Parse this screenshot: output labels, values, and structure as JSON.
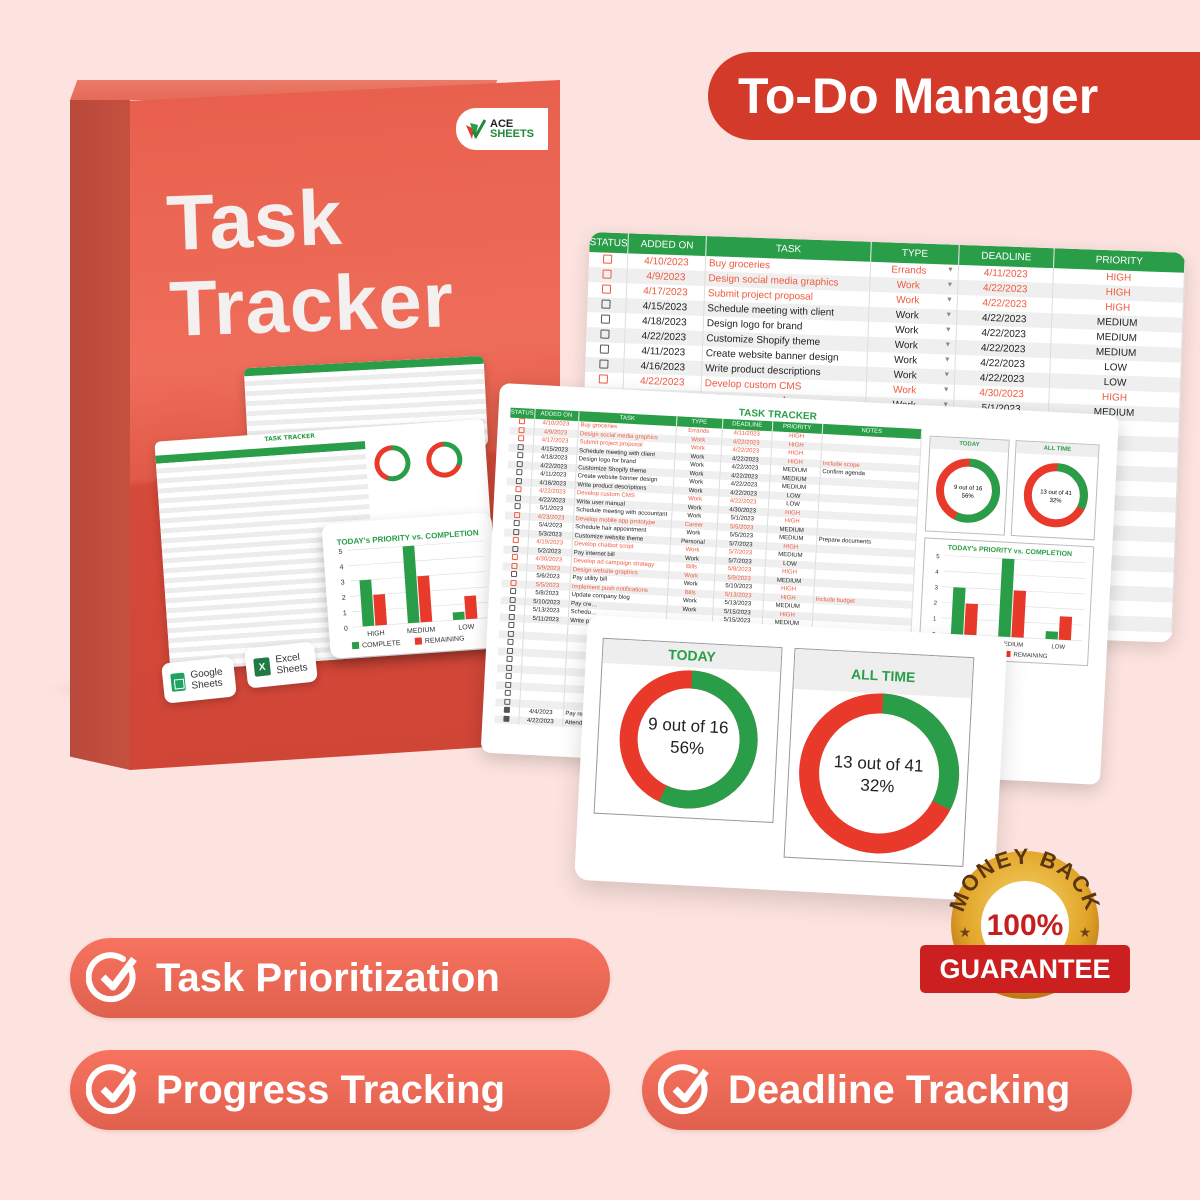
{
  "header": {
    "pill_label": "To-Do Manager"
  },
  "box": {
    "brand_line1": "ACE",
    "brand_line2": "SHEETS",
    "title_line1": "Task",
    "title_line2": "Tracker",
    "platforms": [
      {
        "label_line1": "Google",
        "label_line2": "Sheets",
        "icon": "google-sheets-icon"
      },
      {
        "label_line1": "Excel",
        "label_line2": "Sheets",
        "icon": "excel-icon",
        "icon_glyph": "X"
      }
    ],
    "mini_chart": {
      "title": "TODAY's PRIORITY vs. COMPLETION"
    }
  },
  "colors": {
    "accent_red": "#d43a2a",
    "feature_red": "#f0685a",
    "sheet_green": "#2a9d48",
    "highlight_orange": "#ef5a3f",
    "background": "#fde3df"
  },
  "sheet_back": {
    "columns": [
      "STATUS",
      "ADDED ON",
      "TASK",
      "TYPE",
      "DEADLINE",
      "PRIORITY"
    ],
    "rows": [
      {
        "status": "unchecked-red",
        "added": "4/10/2023",
        "task": "Buy groceries",
        "type": "Errands",
        "deadline": "4/11/2023",
        "priority": "HIGH",
        "hl": true
      },
      {
        "status": "unchecked-red",
        "added": "4/9/2023",
        "task": "Design social media graphics",
        "type": "Work",
        "deadline": "4/22/2023",
        "priority": "HIGH",
        "hl": true
      },
      {
        "status": "unchecked-red",
        "added": "4/17/2023",
        "task": "Submit project proposal",
        "type": "Work",
        "deadline": "4/22/2023",
        "priority": "HIGH",
        "hl": true
      },
      {
        "status": "unchecked",
        "added": "4/15/2023",
        "task": "Schedule meeting with client",
        "type": "Work",
        "deadline": "4/22/2023",
        "priority": "MEDIUM",
        "hl": false
      },
      {
        "status": "unchecked",
        "added": "4/18/2023",
        "task": "Design logo for brand",
        "type": "Work",
        "deadline": "4/22/2023",
        "priority": "MEDIUM",
        "hl": false
      },
      {
        "status": "unchecked",
        "added": "4/22/2023",
        "task": "Customize Shopify theme",
        "type": "Work",
        "deadline": "4/22/2023",
        "priority": "MEDIUM",
        "hl": false
      },
      {
        "status": "unchecked",
        "added": "4/11/2023",
        "task": "Create website banner design",
        "type": "Work",
        "deadline": "4/22/2023",
        "priority": "LOW",
        "hl": false
      },
      {
        "status": "unchecked",
        "added": "4/16/2023",
        "task": "Write product descriptions",
        "type": "Work",
        "deadline": "4/22/2023",
        "priority": "LOW",
        "hl": false
      },
      {
        "status": "unchecked-red",
        "added": "4/22/2023",
        "task": "Develop custom CMS",
        "type": "Work",
        "deadline": "4/30/2023",
        "priority": "HIGH",
        "hl": true
      },
      {
        "status": "unchecked",
        "added": "4/22/2023",
        "task": "Write user manual",
        "type": "Work",
        "deadline": "5/1/2023",
        "priority": "MEDIUM",
        "hl": false
      }
    ]
  },
  "sheet_mid": {
    "title": "TASK TRACKER",
    "columns": [
      "STATUS",
      "ADDED ON",
      "TASK",
      "TYPE",
      "DEADLINE",
      "PRIORITY",
      "NOTES"
    ],
    "rows": [
      {
        "added": "4/10/2023",
        "task": "Buy groceries",
        "type": "Errands",
        "deadline": "4/11/2023",
        "priority": "HIGH",
        "notes": "",
        "hl": true
      },
      {
        "added": "4/9/2023",
        "task": "Design social media graphics",
        "type": "Work",
        "deadline": "4/22/2023",
        "priority": "HIGH",
        "notes": "",
        "hl": true
      },
      {
        "added": "4/17/2023",
        "task": "Submit project proposal",
        "type": "Work",
        "deadline": "4/22/2023",
        "priority": "HIGH",
        "notes": "",
        "hl": true
      },
      {
        "added": "4/15/2023",
        "task": "Schedule meeting with client",
        "type": "Work",
        "deadline": "4/22/2023",
        "priority": "HIGH",
        "notes": "Include scope",
        "hl": false,
        "hl_priority": true
      },
      {
        "added": "4/18/2023",
        "task": "Design logo for brand",
        "type": "Work",
        "deadline": "4/22/2023",
        "priority": "MEDIUM",
        "notes": "Confirm agenda",
        "hl": false
      },
      {
        "added": "4/22/2023",
        "task": "Customize Shopify theme",
        "type": "Work",
        "deadline": "4/22/2023",
        "priority": "MEDIUM",
        "notes": "",
        "hl": false
      },
      {
        "added": "4/11/2023",
        "task": "Create website banner design",
        "type": "Work",
        "deadline": "4/22/2023",
        "priority": "MEDIUM",
        "notes": "",
        "hl": false
      },
      {
        "added": "4/16/2023",
        "task": "Write product descriptions",
        "type": "Work",
        "deadline": "4/22/2023",
        "priority": "LOW",
        "notes": "",
        "hl": false
      },
      {
        "added": "4/22/2023",
        "task": "Develop custom CMS",
        "type": "Work",
        "deadline": "4/22/2023",
        "priority": "LOW",
        "notes": "",
        "hl": true
      },
      {
        "added": "4/22/2023",
        "task": "Write user manual",
        "type": "Work",
        "deadline": "4/30/2023",
        "priority": "HIGH",
        "notes": "",
        "hl": false
      },
      {
        "added": "5/1/2023",
        "task": "Schedule meeting with accountant",
        "type": "Work",
        "deadline": "5/1/2023",
        "priority": "HIGH",
        "notes": "",
        "hl": false
      },
      {
        "added": "4/23/2023",
        "task": "Develop mobile app prototype",
        "type": "Career",
        "deadline": "5/5/2023",
        "priority": "MEDIUM",
        "notes": "",
        "hl": true
      },
      {
        "added": "5/4/2023",
        "task": "Schedule hair appointment",
        "type": "Work",
        "deadline": "5/5/2023",
        "priority": "MEDIUM",
        "notes": "Prepare documents",
        "hl": false
      },
      {
        "added": "5/3/2023",
        "task": "Customize website theme",
        "type": "Personal",
        "deadline": "5/7/2023",
        "priority": "HIGH",
        "notes": "",
        "hl": false
      },
      {
        "added": "4/19/2023",
        "task": "Develop chatbot script",
        "type": "Work",
        "deadline": "5/7/2023",
        "priority": "MEDIUM",
        "notes": "",
        "hl": true
      },
      {
        "added": "5/2/2023",
        "task": "Pay internet bill",
        "type": "Work",
        "deadline": "5/7/2023",
        "priority": "LOW",
        "notes": "",
        "hl": false
      },
      {
        "added": "4/30/2023",
        "task": "Develop ad campaign strategy",
        "type": "Bills",
        "deadline": "5/8/2023",
        "priority": "HIGH",
        "notes": "",
        "hl": true
      },
      {
        "added": "5/9/2023",
        "task": "Design website graphics",
        "type": "Work",
        "deadline": "5/9/2023",
        "priority": "MEDIUM",
        "notes": "",
        "hl": true
      },
      {
        "added": "5/6/2023",
        "task": "Pay utility bill",
        "type": "Work",
        "deadline": "5/10/2023",
        "priority": "HIGH",
        "notes": "",
        "hl": false
      },
      {
        "added": "5/5/2023",
        "task": "Implement push notifications",
        "type": "Bills",
        "deadline": "5/13/2023",
        "priority": "HIGH",
        "notes": "Include budget",
        "hl": true
      },
      {
        "added": "5/8/2023",
        "task": "Update company blog",
        "type": "Work",
        "deadline": "5/13/2023",
        "priority": "MEDIUM",
        "notes": "",
        "hl": false
      },
      {
        "added": "5/10/2023",
        "task": "Pay cre…",
        "type": "Work",
        "deadline": "5/15/2023",
        "priority": "HIGH",
        "notes": "",
        "hl": false
      },
      {
        "added": "5/13/2023",
        "task": "Schedu…",
        "type": "",
        "deadline": "5/15/2023",
        "priority": "MEDIUM",
        "notes": "",
        "hl": false
      },
      {
        "added": "5/11/2023",
        "task": "Write p…",
        "type": "",
        "deadline": "",
        "priority": "",
        "notes": "",
        "hl": false
      }
    ],
    "footer_rows": [
      {
        "added": "4/4/2023",
        "task": "Pay ren…"
      },
      {
        "added": "4/22/2023",
        "task": "Attend…"
      }
    ]
  },
  "dashboard": {
    "today": {
      "title": "TODAY",
      "label_line1": "9 out of 16",
      "label_line2": "56%",
      "complete": 9,
      "total": 16,
      "percent": 56
    },
    "all_time": {
      "title": "ALL TIME",
      "label_line1": "13 out of 41",
      "label_line2": "32%",
      "complete": 13,
      "total": 41,
      "percent": 32
    }
  },
  "chart_data": {
    "type": "bar",
    "title": "TODAY's PRIORITY vs. COMPLETION",
    "categories": [
      "HIGH",
      "MEDIUM",
      "LOW"
    ],
    "series": [
      {
        "name": "COMPLETE",
        "color": "#2a9d48",
        "values": [
          3,
          5,
          0.5
        ]
      },
      {
        "name": "REMAINING",
        "color": "#e8392b",
        "values": [
          2,
          3,
          1.5
        ]
      }
    ],
    "yticks": [
      0,
      1,
      2,
      3,
      4,
      5
    ],
    "ylim": [
      0,
      5
    ],
    "legend": "bottom",
    "grid": true
  },
  "guarantee": {
    "arc_text": "MONEY BACK",
    "percent": "100%",
    "ribbon": "GUARANTEE"
  },
  "features": [
    {
      "label": "Task Prioritization",
      "icon": "check-circle-icon"
    },
    {
      "label": "Progress Tracking",
      "icon": "check-circle-icon"
    },
    {
      "label": "Deadline Tracking",
      "icon": "check-circle-icon"
    }
  ]
}
